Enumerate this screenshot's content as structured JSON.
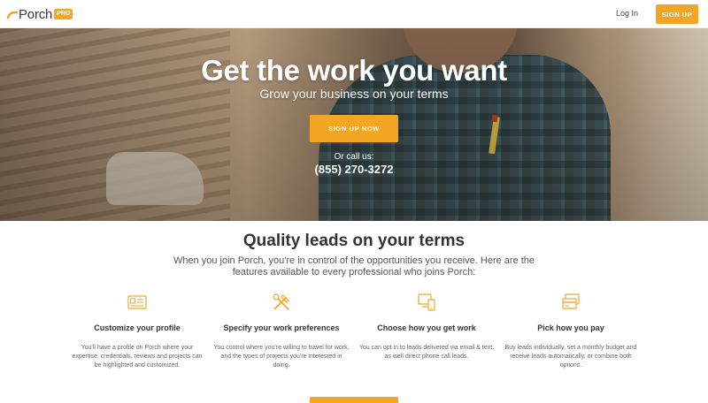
{
  "header": {
    "logo_text": "Porch",
    "logo_badge": "PRO",
    "login_label": "Log In",
    "signup_label": "SIGN UP"
  },
  "hero": {
    "title": "Get the work you want",
    "subtitle": "Grow your business on your terms",
    "cta_label": "SIGN UP NOW",
    "call_label": "Or call us:",
    "phone": "(855) 270-3272"
  },
  "features_section": {
    "title": "Quality leads on your terms",
    "intro": "When you join Porch, you're in control of the opportunities you receive. Here are the features available to every professional who joins Porch:",
    "items": [
      {
        "icon": "profile-card-icon",
        "title": "Customize your profile",
        "description": "You'll have a profile on Porch where your expertise, credentials, reviews and projects can be highlighted and customized."
      },
      {
        "icon": "tools-icon",
        "title": "Specify your work preferences",
        "description": "You control where you're willing to travel for work, and the types of projects you're interested in doing."
      },
      {
        "icon": "devices-icon",
        "title": "Choose how you get work",
        "description": "You can opt in to leads delivered via email & text, as well direct phone call leads."
      },
      {
        "icon": "cards-icon",
        "title": "Pick how you pay",
        "description": "Buy leads individually, set a monthly budget and receive leads automatically, or combine both options."
      }
    ]
  },
  "colors": {
    "accent": "#f2a624",
    "text": "#333333"
  }
}
